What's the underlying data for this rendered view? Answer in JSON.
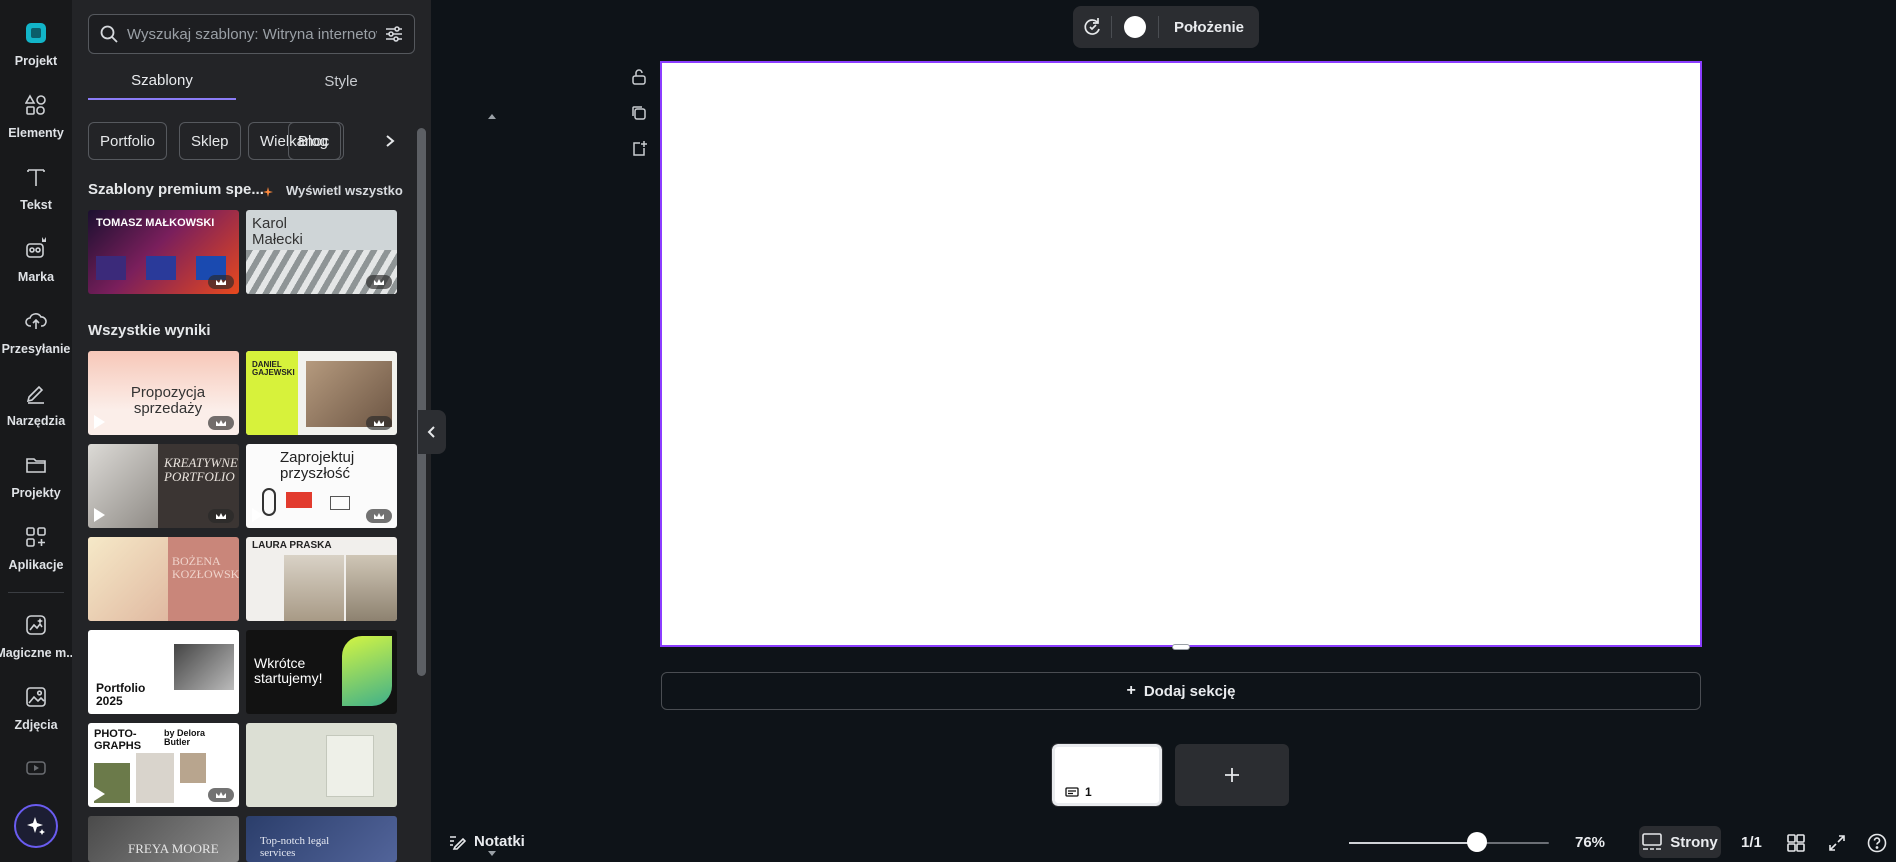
{
  "colors": {
    "accent": "#8b3dff",
    "tab_underline": "#8b7cf6",
    "bg": "#0e1318",
    "panel": "#232427",
    "rail": "#18191b"
  },
  "rail": {
    "items": [
      {
        "label": "Projekt",
        "icon": "design-logo-icon"
      },
      {
        "label": "Elementy",
        "icon": "shapes-icon"
      },
      {
        "label": "Tekst",
        "icon": "text-t-icon"
      },
      {
        "label": "Marka",
        "icon": "brand-icon"
      },
      {
        "label": "Przesyłanie",
        "icon": "cloud-upload-icon"
      },
      {
        "label": "Narzędzia",
        "icon": "pen-tools-icon"
      },
      {
        "label": "Projekty",
        "icon": "folder-icon"
      },
      {
        "label": "Aplikacje",
        "icon": "apps-grid-icon"
      },
      {
        "label": "Magiczne m...",
        "icon": "magic-media-icon"
      },
      {
        "label": "Zdjęcia",
        "icon": "photo-icon"
      }
    ]
  },
  "panel": {
    "search_placeholder": "Wyszukaj szablony: Witryna internetowa",
    "tabs": [
      "Szablony",
      "Style"
    ],
    "chips": [
      "Portfolio",
      "Sklep",
      "Wielkanoc",
      "Blog"
    ],
    "premium_title": "Szablony premium spe...",
    "see_all": "Wyświetl wszystko",
    "all_results": "Wszystkie wyniki",
    "premium_thumbs": [
      {
        "text": "TOMASZ MAŁKOWSKI"
      },
      {
        "text": "Karol Małecki"
      }
    ],
    "result_thumbs": [
      {
        "text": "Propozycja sprzedaży"
      },
      {
        "text": "DANIEL GAJEWSKI"
      },
      {
        "text": "KREATYWNE PORTFOLIO"
      },
      {
        "text": "Zaprojektuj przyszłość"
      },
      {
        "text": "BOŻENA KOZŁOWSKA"
      },
      {
        "text": "LAURA PRASKA"
      },
      {
        "text": "Portfolio 2025"
      },
      {
        "text": "Wkrótce startujemy!"
      },
      {
        "text": "PHOTO-GRAPHS"
      },
      {
        "text": ""
      },
      {
        "text": "FREYA MOORE"
      },
      {
        "text": "Top-notch legal services"
      }
    ],
    "photographs_byline": "by Delora Butler"
  },
  "toolbar": {
    "position_label": "Położenie"
  },
  "canvas": {
    "add_section": "Dodaj sekcję",
    "page_number": "1"
  },
  "bottom": {
    "notes": "Notatki",
    "zoom": "76%",
    "zoom_fraction": 0.64,
    "pages": "Strony",
    "page_count": "1/1"
  }
}
